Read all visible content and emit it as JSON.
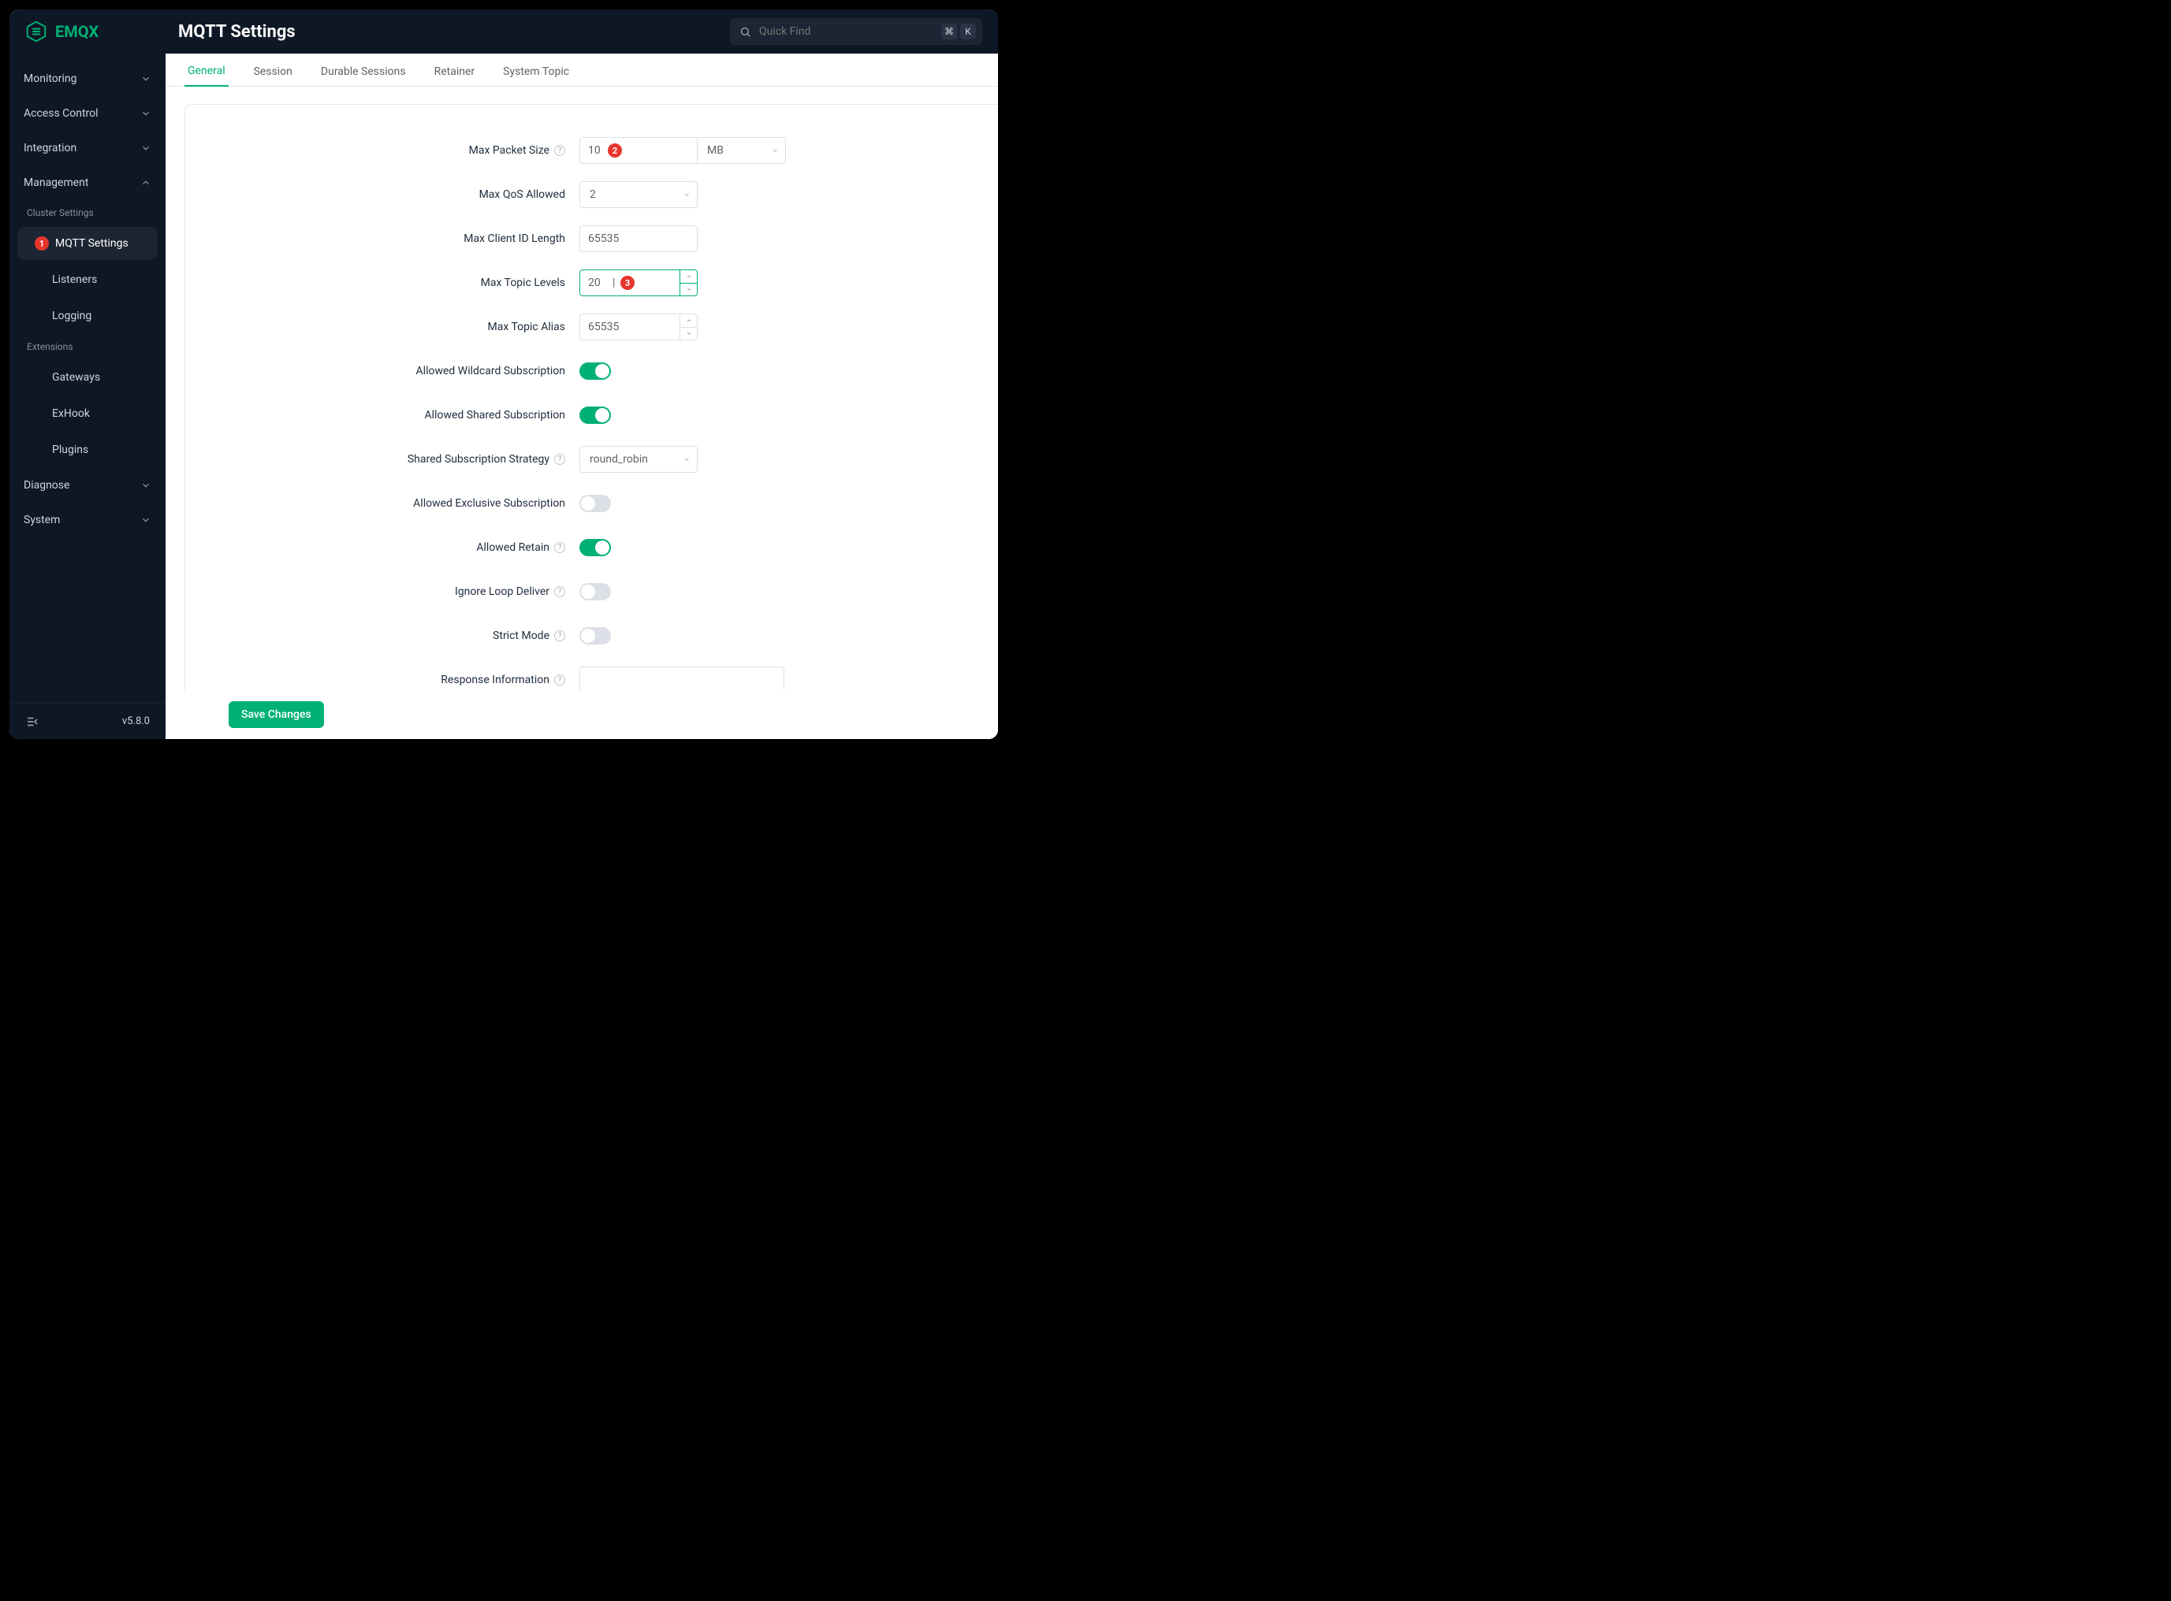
{
  "brand": {
    "name": "EMQX"
  },
  "page_title": "MQTT Settings",
  "search": {
    "placeholder": "Quick Find",
    "kbd1": "⌘",
    "kbd2": "K"
  },
  "sidebar": {
    "groups": [
      {
        "label": "Monitoring",
        "kind": "expandable",
        "expanded": false
      },
      {
        "label": "Access Control",
        "kind": "expandable",
        "expanded": false
      },
      {
        "label": "Integration",
        "kind": "expandable",
        "expanded": false
      },
      {
        "label": "Management",
        "kind": "expandable",
        "expanded": true
      }
    ],
    "management_header": "Cluster Settings",
    "management_items": [
      {
        "label": "MQTT Settings",
        "active": true,
        "badge": "1"
      },
      {
        "label": "Listeners",
        "active": false
      },
      {
        "label": "Logging",
        "active": false
      }
    ],
    "extensions_header": "Extensions",
    "extensions_items": [
      {
        "label": "Gateways"
      },
      {
        "label": "ExHook"
      },
      {
        "label": "Plugins"
      }
    ],
    "trailing": [
      {
        "label": "Diagnose",
        "kind": "expandable",
        "expanded": false
      },
      {
        "label": "System",
        "kind": "expandable",
        "expanded": false
      }
    ],
    "version": "v5.8.0"
  },
  "tabs": [
    {
      "label": "General",
      "active": true
    },
    {
      "label": "Session",
      "active": false
    },
    {
      "label": "Durable Sessions",
      "active": false
    },
    {
      "label": "Retainer",
      "active": false
    },
    {
      "label": "System Topic",
      "active": false
    }
  ],
  "form": {
    "max_packet_size": {
      "label": "Max Packet Size",
      "help": true,
      "value": "10",
      "unit": "MB",
      "badge": "2"
    },
    "max_qos_allowed": {
      "label": "Max QoS Allowed",
      "help": false,
      "value": "2"
    },
    "max_client_id_length": {
      "label": "Max Client ID Length",
      "help": false,
      "value": "65535"
    },
    "max_topic_levels": {
      "label": "Max Topic Levels",
      "help": false,
      "value": "20",
      "badge": "3",
      "focused": true
    },
    "max_topic_alias": {
      "label": "Max Topic Alias",
      "help": false,
      "value": "65535"
    },
    "allowed_wildcard_subscription": {
      "label": "Allowed Wildcard Subscription",
      "help": false,
      "on": true
    },
    "allowed_shared_subscription": {
      "label": "Allowed Shared Subscription",
      "help": false,
      "on": true
    },
    "shared_subscription_strategy": {
      "label": "Shared Subscription Strategy",
      "help": true,
      "value": "round_robin"
    },
    "allowed_exclusive_subscription": {
      "label": "Allowed Exclusive Subscription",
      "help": false,
      "on": false
    },
    "allowed_retain": {
      "label": "Allowed Retain",
      "help": true,
      "on": true
    },
    "ignore_loop_deliver": {
      "label": "Ignore Loop Deliver",
      "help": true,
      "on": false
    },
    "strict_mode": {
      "label": "Strict Mode",
      "help": true,
      "on": false
    },
    "response_information": {
      "label": "Response Information",
      "help": true,
      "value": ""
    }
  },
  "save_label": "Save Changes"
}
